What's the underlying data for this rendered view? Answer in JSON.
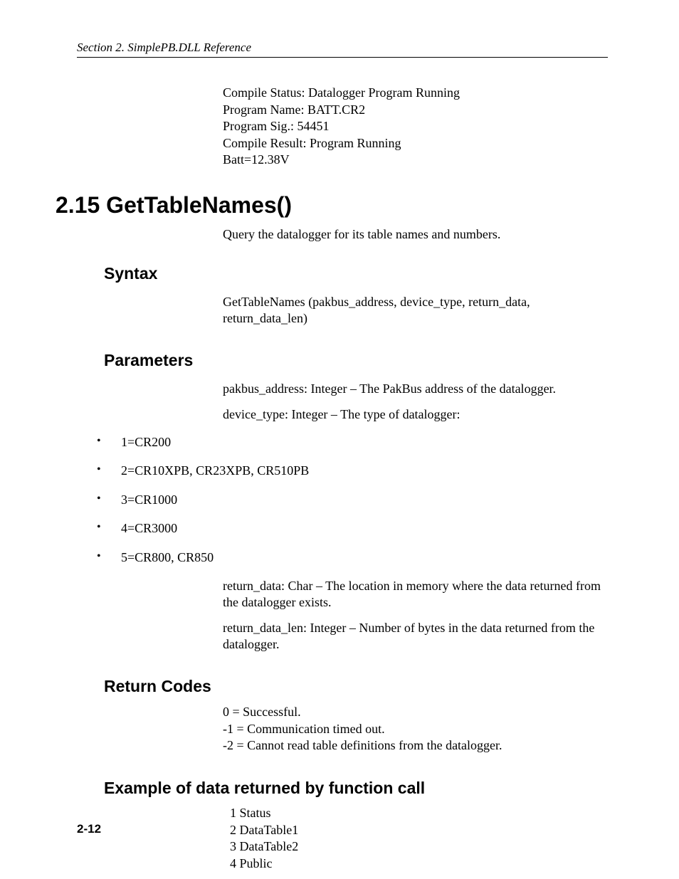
{
  "header": {
    "running_head": "Section 2.  SimplePB.DLL Reference"
  },
  "preamble": {
    "lines": [
      "Compile Status: Datalogger Program Running",
      "Program Name: BATT.CR2",
      "Program Sig.: 54451",
      "Compile Result: Program Running",
      "Batt=12.38V"
    ]
  },
  "section": {
    "heading": "2.15  GetTableNames()",
    "description": "Query the datalogger for its table names and numbers."
  },
  "syntax": {
    "heading": "Syntax",
    "text": "GetTableNames (pakbus_address, device_type, return_data, return_data_len)"
  },
  "parameters": {
    "heading": "Parameters",
    "p1": "pakbus_address: Integer – The PakBus address of the datalogger.",
    "p2": "device_type: Integer – The type of datalogger:",
    "device_types": [
      "1=CR200",
      "2=CR10XPB, CR23XPB, CR510PB",
      "3=CR1000",
      "4=CR3000",
      "5=CR800, CR850"
    ],
    "p3": "return_data: Char – The location in memory where the data returned from the datalogger exists.",
    "p4": "return_data_len: Integer – Number of bytes in the data returned from the datalogger."
  },
  "return_codes": {
    "heading": "Return Codes",
    "codes": [
      " 0 = Successful.",
      "-1 = Communication timed out.",
      "-2 = Cannot read table definitions from the datalogger."
    ]
  },
  "example": {
    "heading": "Example of data returned by function call",
    "rows": [
      "1 Status",
      "2 DataTable1",
      "3 DataTable2",
      "4 Public"
    ]
  },
  "footer": {
    "page_number": "2-12"
  }
}
